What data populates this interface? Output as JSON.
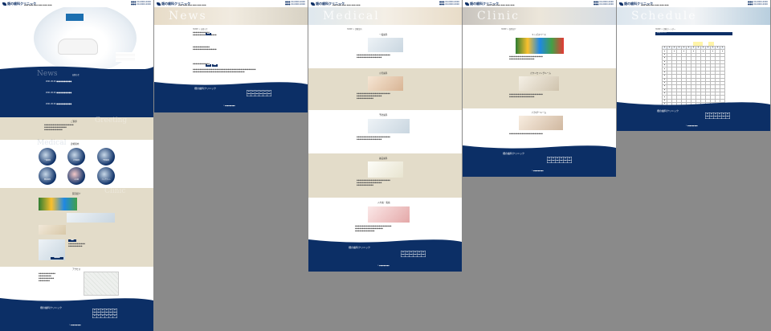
{
  "site": {
    "logo_text": "畑の歯科クリニック",
    "tel_line1": "●●● 00-0000-0000",
    "tel_line2": "●●● 00-0000-0000",
    "nav": "●●●  ●●●  ●●●  ●●●  ●●●  ●●●"
  },
  "colors": {
    "navy": "#0c2f66",
    "beige": "#e3dcc9"
  },
  "pages": [
    {
      "name": "top",
      "sections": {
        "news_ghost": "News",
        "news_title": "お知らせ",
        "news_items": [
          "2021.00.00 ●●●●●●●●●●",
          "2021.00.00 ●●●●●●●●●●",
          "2021.00.00 ●●●●●●●●●●"
        ],
        "greeting_ghost": "Greeting",
        "greeting_title": "ご挨拶",
        "medical_ghost": "Medical",
        "medical_title": "診療案内",
        "circles": [
          "一般歯科",
          "小児歯科",
          "予防歯科",
          "審美歯科",
          "入れ歯",
          "インプラント"
        ],
        "clinic_ghost": "Clinic",
        "clinic_title": "医院紹介",
        "access_title": "アクセス"
      }
    },
    {
      "name": "news",
      "hero_title": "News",
      "breadcrumb": "HOME > お知らせ"
    },
    {
      "name": "medical",
      "hero_title": "Medical",
      "breadcrumb": "HOME > 診療案内",
      "items": [
        "一般歯科",
        "小児歯科",
        "予防歯科",
        "審美歯科",
        "入れ歯・義歯"
      ]
    },
    {
      "name": "clinic",
      "hero_title": "Clinic",
      "breadcrumb": "HOME > 医院紹介",
      "items": [
        "キッズスペース",
        "カウンセリングルーム",
        "パウダールーム"
      ]
    },
    {
      "name": "schedule",
      "hero_title": "Schedule",
      "breadcrumb": "HOME > 診療カレンダー",
      "table_title": "診療カレンダー"
    }
  ],
  "footer": {
    "logo_text": "畑の歯科クリニック",
    "copyright": "© ●●●●●●●●●"
  }
}
